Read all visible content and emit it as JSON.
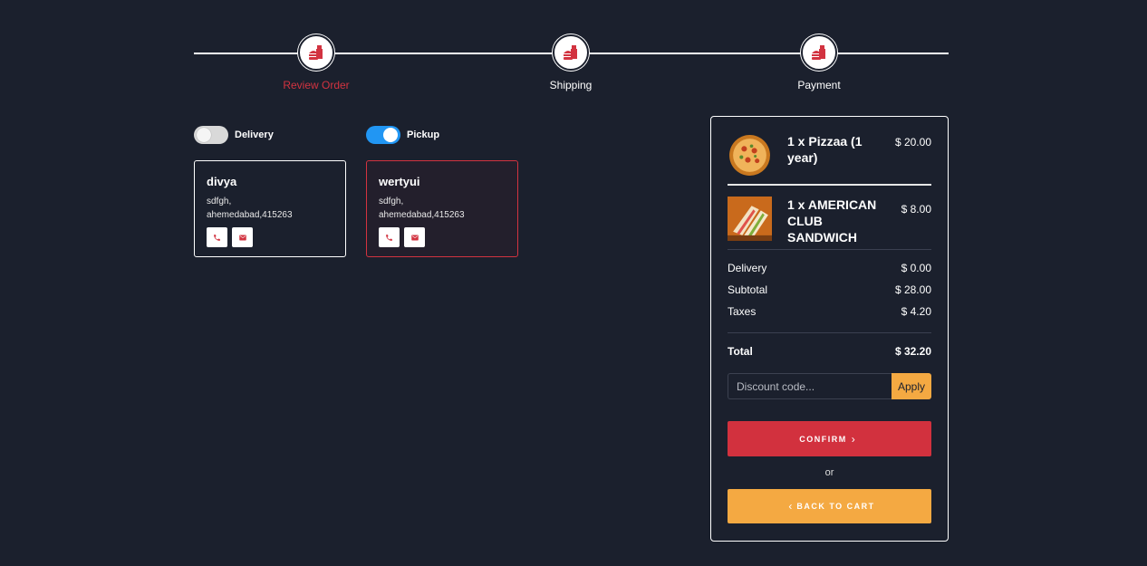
{
  "stepper": {
    "steps": [
      {
        "label": "Review Order",
        "icon": "fast-food-icon",
        "active": true
      },
      {
        "label": "Shipping",
        "icon": "fast-food-icon",
        "active": false
      },
      {
        "label": "Payment",
        "icon": "fast-food-icon",
        "active": false
      }
    ]
  },
  "toggles": {
    "delivery": {
      "label": "Delivery",
      "on": false
    },
    "pickup": {
      "label": "Pickup",
      "on": true
    }
  },
  "addresses": [
    {
      "name": "divya",
      "line1": "sdfgh,",
      "line2": "ahemedabad,415263",
      "selected": false
    },
    {
      "name": "wertyui",
      "line1": "sdfgh,",
      "line2": "ahemedabad,415263",
      "selected": true
    }
  ],
  "summary": {
    "items": [
      {
        "title": "1 x Pizzaa (1 year)",
        "price": "$ 20.00",
        "image": "pizza"
      },
      {
        "title": "1 x AMERICAN CLUB SANDWICH",
        "price": "$ 8.00",
        "image": "sandwich"
      }
    ],
    "delivery_label": "Delivery",
    "delivery_value": "$ 0.00",
    "subtotal_label": "Subtotal",
    "subtotal_value": "$ 28.00",
    "taxes_label": "Taxes",
    "taxes_value": "$ 4.20",
    "total_label": "Total",
    "total_value": "$ 32.20",
    "discount_placeholder": "Discount code...",
    "apply_label": "Apply",
    "confirm_label": "CONFIRM",
    "or_label": "or",
    "back_label": "BACK TO CART"
  },
  "colors": {
    "background": "#1b202d",
    "accent_red": "#d2313e",
    "accent_orange": "#f4a942",
    "toggle_blue": "#2196f3"
  }
}
